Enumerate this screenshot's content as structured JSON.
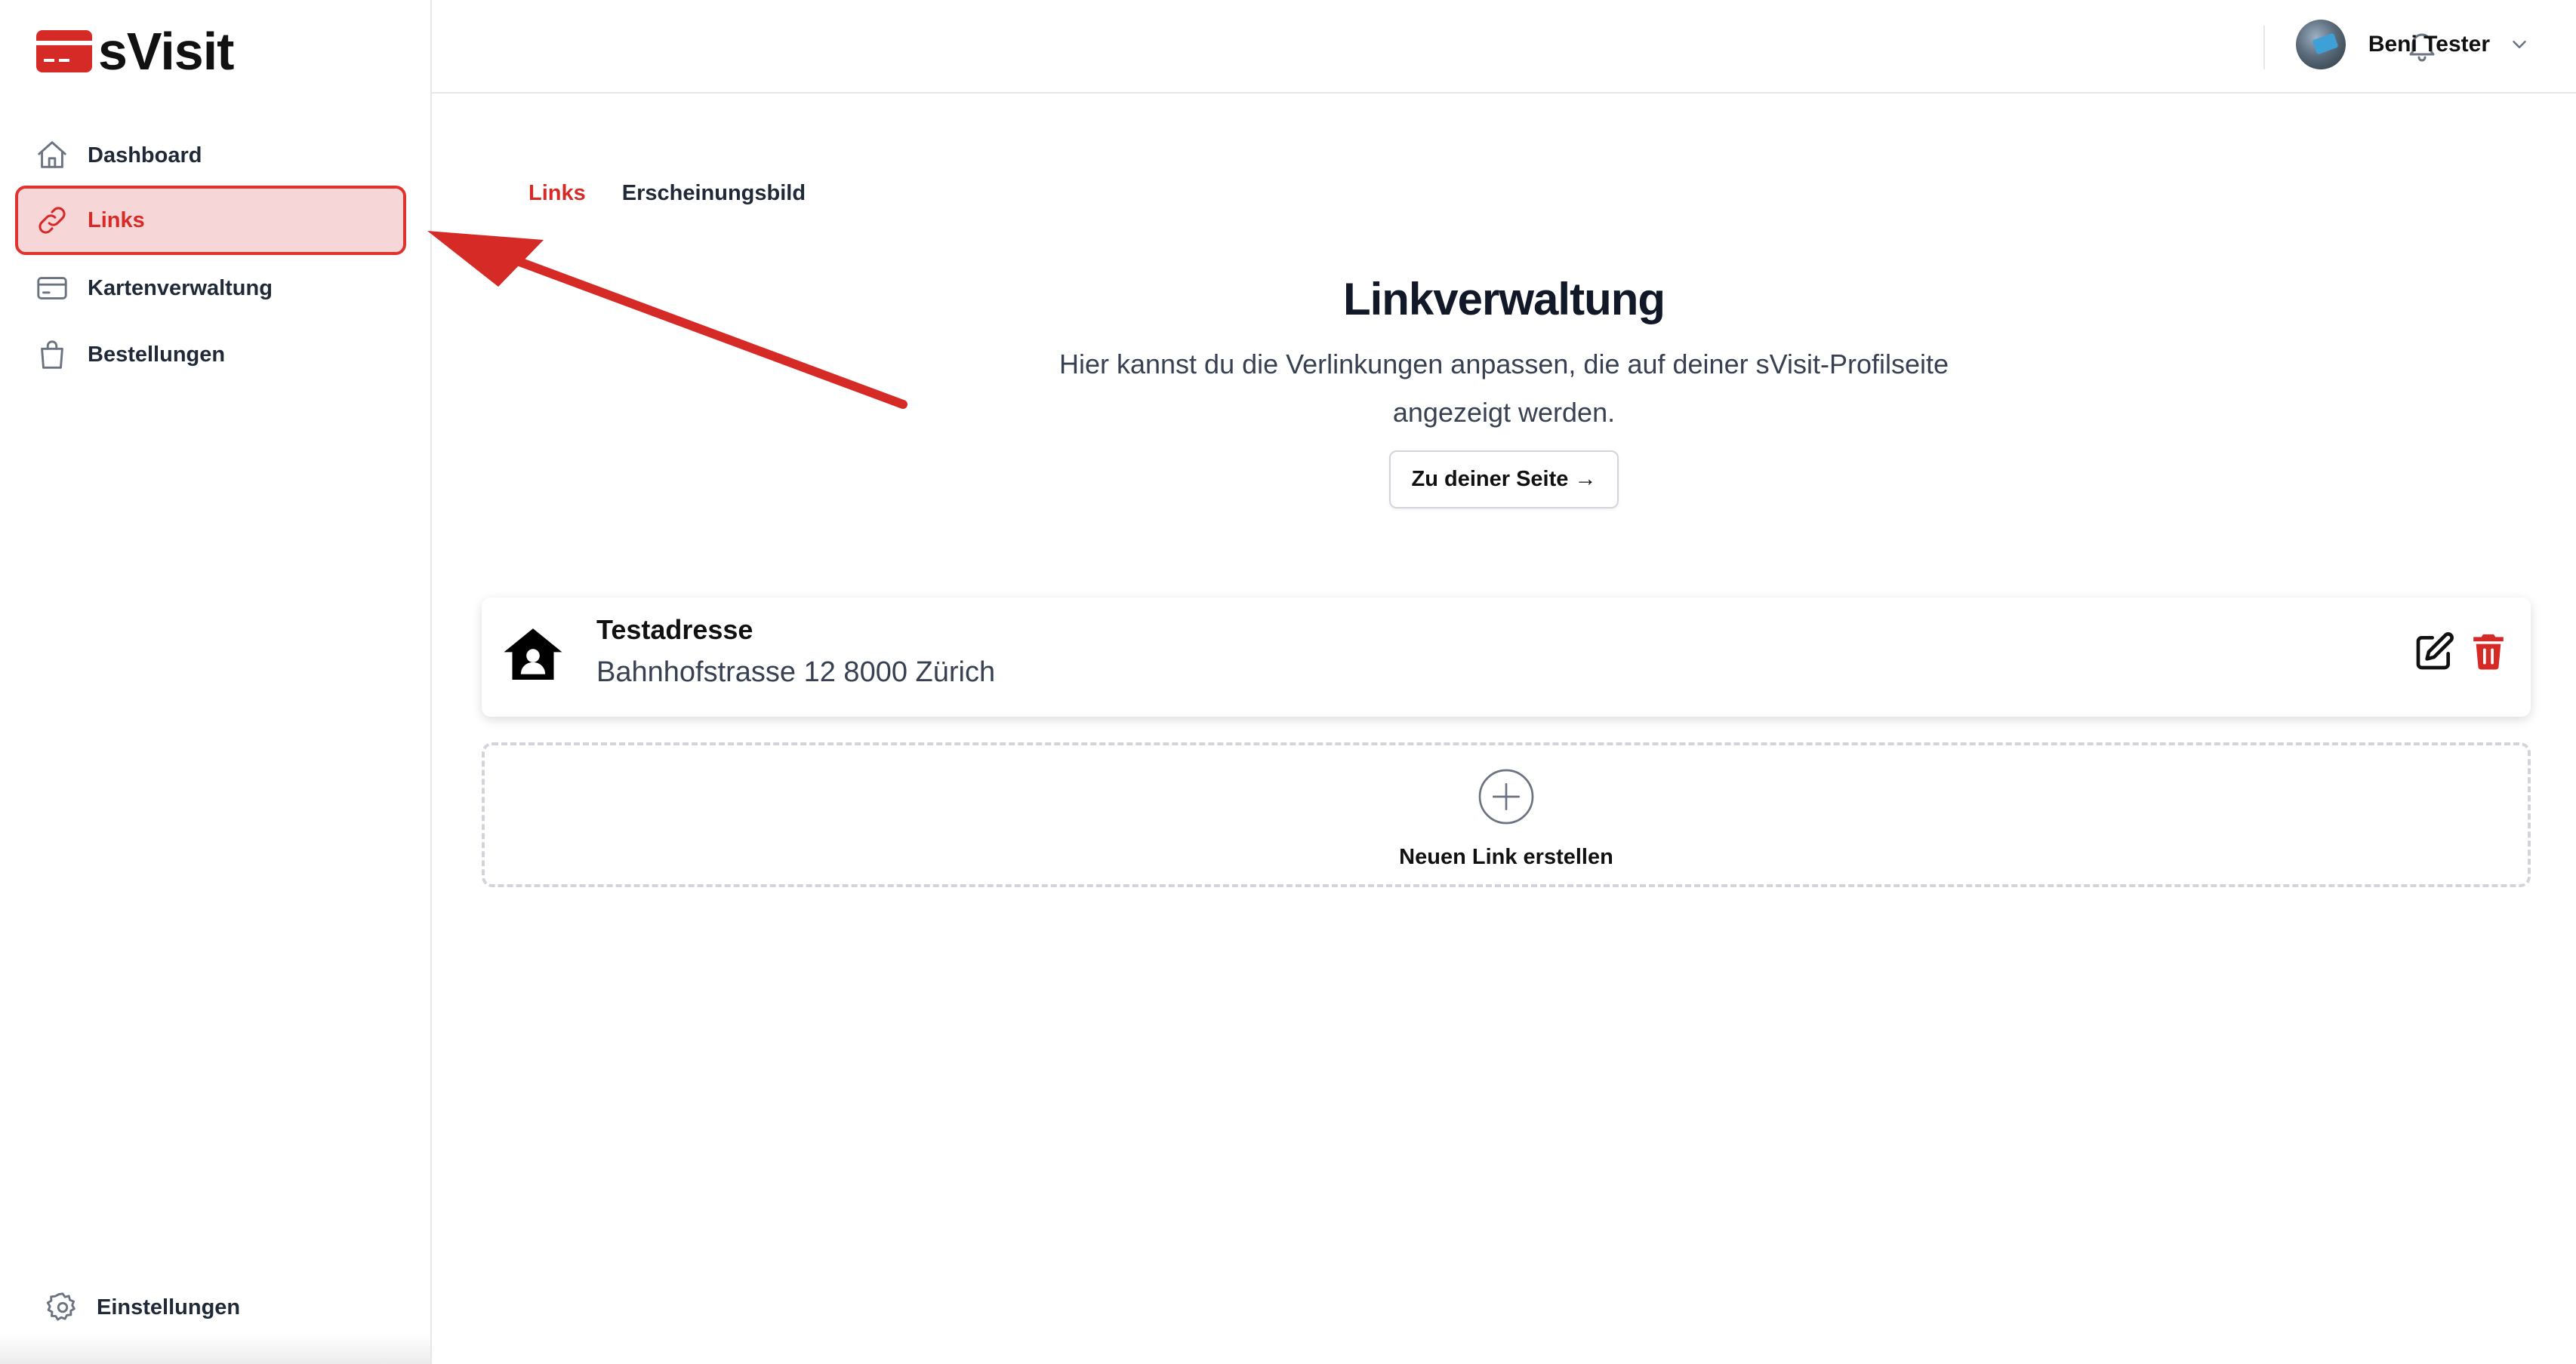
{
  "brand": {
    "name": "sVisit",
    "accent": "#d62a27"
  },
  "sidebar": {
    "items": [
      {
        "label": "Dashboard",
        "icon": "home-icon"
      },
      {
        "label": "Links",
        "icon": "link-icon",
        "active": true
      },
      {
        "label": "Kartenverwaltung",
        "icon": "credit-card-icon"
      },
      {
        "label": "Bestellungen",
        "icon": "shopping-bag-icon"
      }
    ],
    "settings_label": "Einstellungen"
  },
  "topbar": {
    "user_name": "Beni Tester"
  },
  "tabs": [
    {
      "label": "Links",
      "active": true
    },
    {
      "label": "Erscheinungsbild"
    }
  ],
  "hero": {
    "title": "Linkverwaltung",
    "description": "Hier kannst du die Verlinkungen anpassen, die auf deiner sVisit-Profilseite angezeigt werden.",
    "button_label": "Zu deiner Seite →"
  },
  "links": [
    {
      "title": "Testadresse",
      "subtitle": "Bahnhofstrasse 12 8000 Zürich",
      "icon": "house-user-icon"
    }
  ],
  "new_link_label": "Neuen Link erstellen"
}
